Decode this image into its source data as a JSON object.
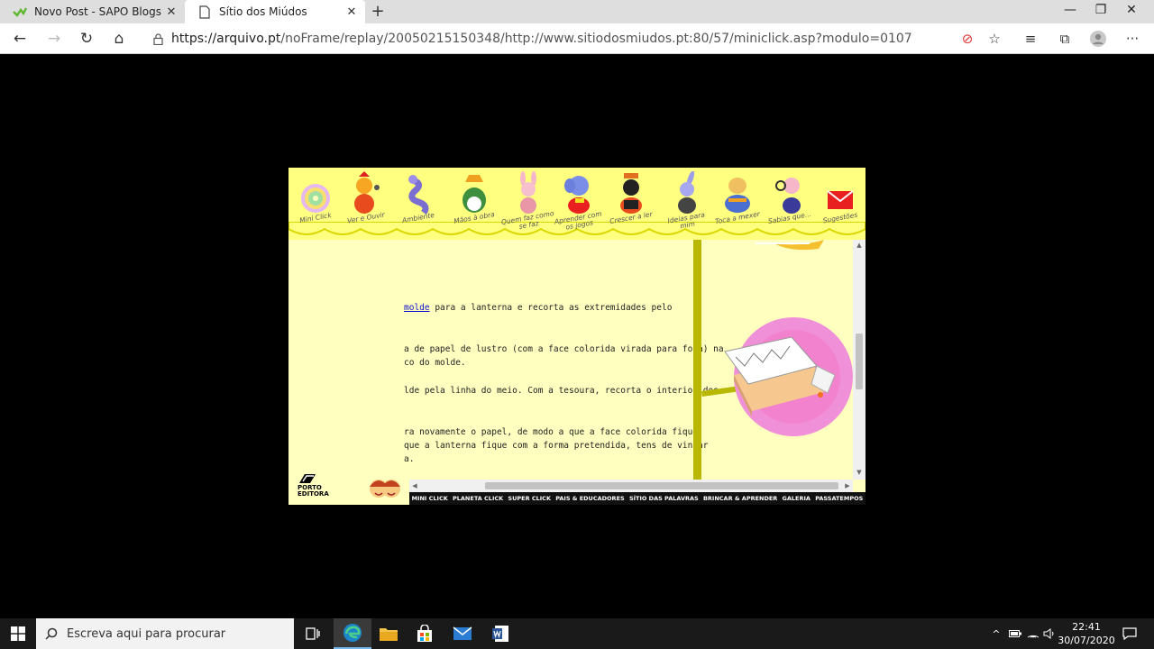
{
  "browser": {
    "tabs": [
      {
        "title": "Novo Post - SAPO Blogs",
        "active": false,
        "icon": "sapo-blogs-favicon"
      },
      {
        "title": "Sítio dos Miúdos",
        "active": true,
        "icon": "page-icon"
      }
    ],
    "new_tab": "+",
    "url_host": "https://arquivo.pt",
    "url_path": "/noFrame/replay/20050215150348/http://www.sitiodosmiudos.pt:80/57/miniclick.asp?modulo=0107"
  },
  "site": {
    "top_nav": [
      {
        "label": "Mini Click"
      },
      {
        "label": "Ver e Ouvir"
      },
      {
        "label": "Ambiente"
      },
      {
        "label": "Mãos à obra"
      },
      {
        "label": "Quem faz como se faz"
      },
      {
        "label": "Aprender com os jogos"
      },
      {
        "label": "Crescer a ler"
      },
      {
        "label": "Ideias para mim"
      },
      {
        "label": "Toca a mexer"
      },
      {
        "label": "Sabias que..."
      },
      {
        "label": "Sugestões"
      }
    ],
    "content": {
      "p1_link": "molde",
      "p1": " para a lanterna e recorta as extremidades pelo",
      "p2a": "a de papel de lustro (com a face colorida virada para fora) na",
      "p2b": "co do molde.",
      "p3": "lde pela linha do meio. Com a tesoura, recorta o interior dos",
      "p4a": "ra novamente o papel, de modo a que a face colorida fique",
      "p4b": " que a lanterna fique com a forma pretendida, tens de vincar",
      "p4c": "a."
    },
    "logo_porto": [
      "PORTO",
      "EDITORA"
    ],
    "logo_sitio": "sitiodosmiudos",
    "bottom_nav": [
      "MINI CLICK",
      "PLANETA CLICK",
      "SUPER CLICK",
      "PAIS & EDUCADORES",
      "SÍTIO DAS PALAVRAS",
      "BRINCAR & APRENDER",
      "GALERIA",
      "PASSATEMPOS"
    ]
  },
  "taskbar": {
    "search_placeholder": "Escreva aqui para procurar",
    "time": "22:41",
    "date": "30/07/2020"
  }
}
